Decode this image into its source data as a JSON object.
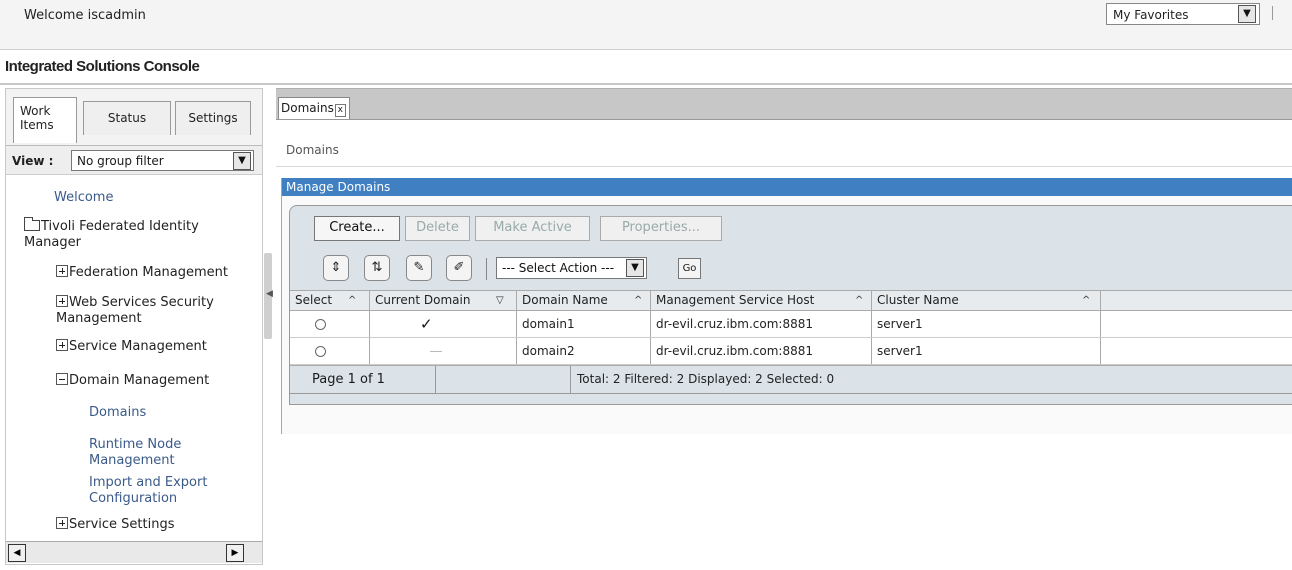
{
  "header": {
    "welcome": "Welcome iscadmin",
    "console_title": "Integrated Solutions Console",
    "favorites": "My Favorites"
  },
  "nav": {
    "tabs": [
      "Work Items",
      "Status",
      "Settings"
    ],
    "view_label": "View :",
    "view_filter": "No group filter",
    "tree": {
      "welcome": "Welcome",
      "tfim": "Tivoli Federated Identity Manager",
      "federation": "Federation Management",
      "web_services": "Web Services Security Management",
      "service_mgmt": "Service Management",
      "domain_mgmt": "Domain Management",
      "domains": "Domains",
      "runtime": "Runtime Node Management",
      "import_export": "Import and Export Configuration",
      "service_settings": "Service Settings"
    }
  },
  "main": {
    "tab_label": "Domains",
    "tab_close": "x",
    "breadcrumb": "Domains",
    "portlet_title": "Manage Domains",
    "buttons": {
      "create": "Create...",
      "delete": "Delete",
      "make_active": "Make Active",
      "properties": "Properties..."
    },
    "action_select": "--- Select Action ---",
    "go": "Go",
    "columns": [
      "Select",
      "Current Domain",
      "Domain Name",
      "Management Service Host",
      "Cluster Name"
    ],
    "rows": [
      {
        "current": true,
        "name": "domain1",
        "host": "dr-evil.cruz.ibm.com:8881",
        "cluster": "server1"
      },
      {
        "current": false,
        "name": "domain2",
        "host": "dr-evil.cruz.ibm.com:8881",
        "cluster": "server1"
      }
    ],
    "page_info": "Page 1 of 1",
    "summary": "Total: 2  Filtered: 2  Displayed: 2  Selected: 0"
  },
  "icons": {
    "select_all": "select-all-icon",
    "deselect_all": "deselect-all-icon",
    "filter": "show-filter-icon",
    "clear_filter": "clear-filter-icon"
  }
}
